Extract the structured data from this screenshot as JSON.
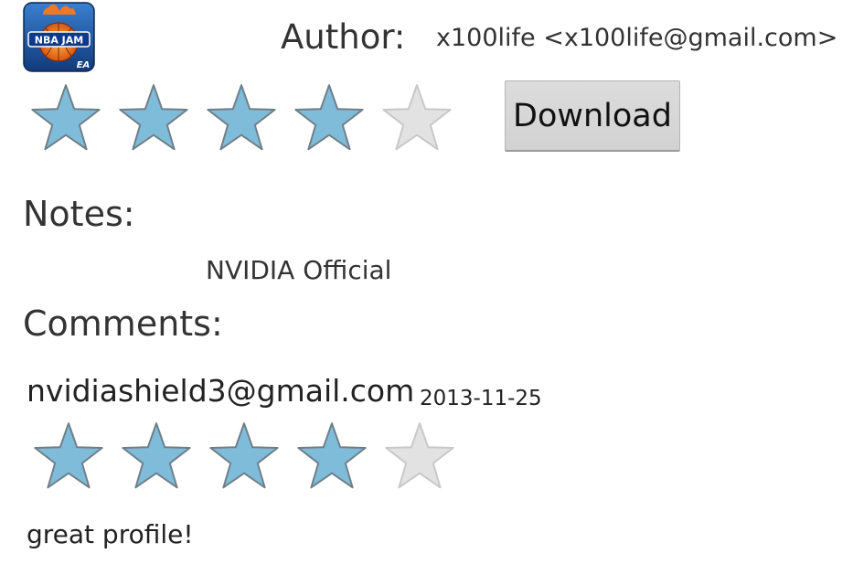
{
  "app": {
    "icon_name": "nba-jam-app-icon",
    "icon_text": "NBA JAM",
    "icon_badge": "EA",
    "author_label": "Author:",
    "author_value": "x100life <x100life@gmail.com>",
    "rating": 4,
    "rating_max": 5,
    "download_label": "Download"
  },
  "notes": {
    "title": "Notes:",
    "value": "NVIDIA Official"
  },
  "comments": {
    "title": "Comments:",
    "items": [
      {
        "author": "nvidiashield3@gmail.com",
        "date": "2013-11-25",
        "rating": 4,
        "rating_max": 5,
        "text": "great profile!"
      }
    ]
  },
  "colors": {
    "star_filled": "#7fbcd9",
    "star_empty": "#e2e2e2",
    "star_stroke": "#6f7f88",
    "star_empty_stroke": "#c8c8c8"
  }
}
